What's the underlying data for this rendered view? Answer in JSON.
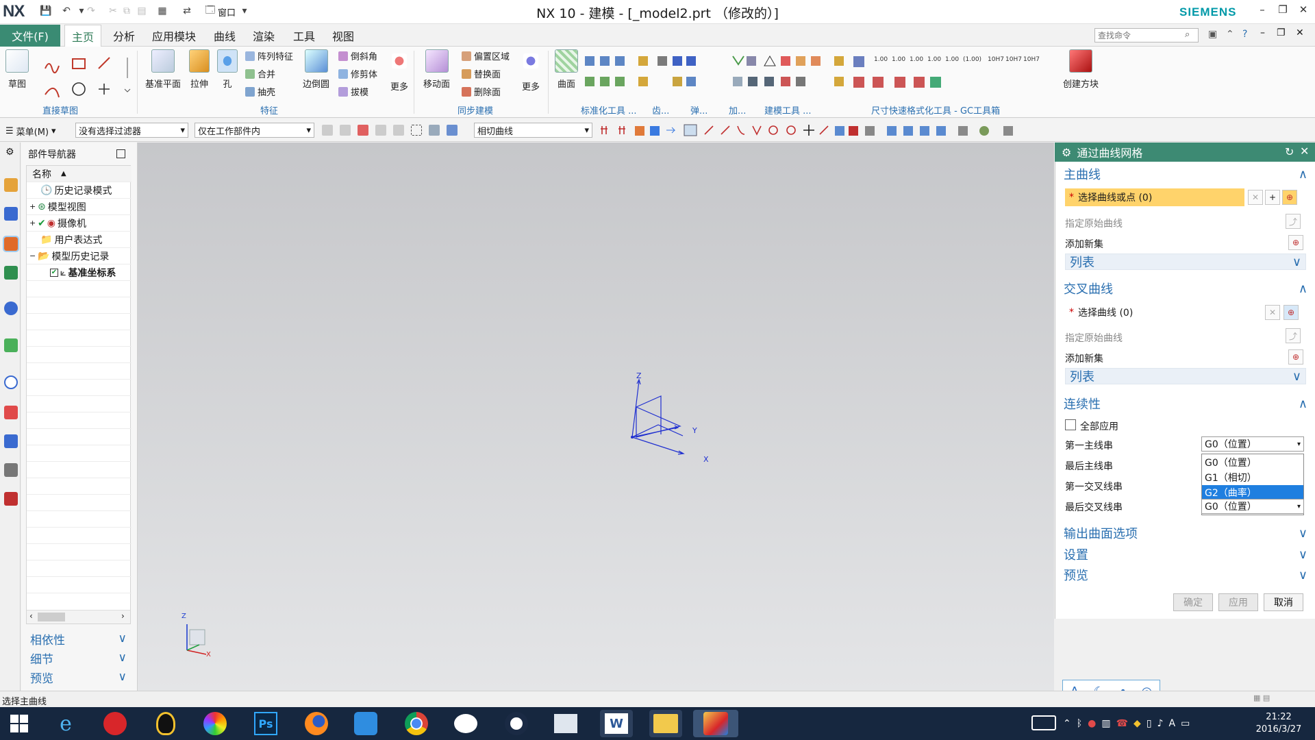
{
  "title_bar": {
    "logo": "NX",
    "window_title": "NX 10 - 建模 - [_model2.prt （修改的）]",
    "brand": "SIEMENS",
    "window_menu": "窗口"
  },
  "menu": {
    "file": "文件(F)",
    "tabs": [
      "主页",
      "分析",
      "应用模块",
      "曲线",
      "渲染",
      "工具",
      "视图"
    ],
    "active_tab": "主页",
    "search_placeholder": "查找命令"
  },
  "ribbon": {
    "sketch": {
      "label": "草图"
    },
    "direct_sketch_group": "直接草图",
    "feature": {
      "datum_plane": "基准平面",
      "extrude": "拉伸",
      "hole": "孔",
      "pattern": "阵列特征",
      "unite": "合并",
      "shell": "抽壳",
      "edge_blend": "边倒圆",
      "chamfer": "倒斜角",
      "trim_body": "修剪体",
      "draft": "拔模",
      "more": "更多"
    },
    "feature_group": "特征",
    "sync": {
      "move_face": "移动面",
      "offset_region": "偏置区域",
      "replace_face": "替换面",
      "delete_face": "删除面",
      "more": "更多"
    },
    "sync_group": "同步建模",
    "surface": {
      "label": "曲面"
    },
    "other_groups": [
      "标准化工具 ...",
      "齿...",
      "弹...",
      "加...",
      "建模工具 ...",
      "尺寸快速格式化工具 - GC工具箱"
    ],
    "dim_labels": [
      "1.00",
      "1.00",
      "1.00",
      "1.00",
      "1.00",
      "(1.00)",
      "10H7",
      "10H7",
      "10H7"
    ],
    "create_block": "创建方块"
  },
  "toolbar2": {
    "menu": "菜单(M)",
    "filter": "没有选择过滤器",
    "scope": "仅在工作部件内",
    "curve_rule": "相切曲线"
  },
  "navigator": {
    "title": "部件导航器",
    "column": "名称",
    "items": [
      {
        "label": "历史记录模式"
      },
      {
        "label": "模型视图"
      },
      {
        "label": "摄像机"
      },
      {
        "label": "用户表达式"
      },
      {
        "label": "模型历史记录"
      },
      {
        "label": "基准坐标系"
      }
    ],
    "sections": [
      "相依性",
      "细节",
      "预览"
    ]
  },
  "viewport": {
    "axis_labels": {
      "z": "Z",
      "y": "Y",
      "x": "X"
    }
  },
  "dialog": {
    "title": "通过曲线网格",
    "primary": {
      "header": "主曲线",
      "select": "选择曲线或点 (0)",
      "specify_original": "指定原始曲线",
      "add_new_set": "添加新集",
      "list": "列表"
    },
    "cross": {
      "header": "交叉曲线",
      "select": "选择曲线 (0)",
      "specify_original": "指定原始曲线",
      "add_new_set": "添加新集",
      "list": "列表"
    },
    "continuity": {
      "header": "连续性",
      "apply_all": "全部应用",
      "first_primary": "第一主线串",
      "last_primary": "最后主线串",
      "first_cross": "第一交叉线串",
      "last_cross": "最后交叉线串",
      "first_primary_value": "G0（位置）",
      "last_cross_value": "G0（位置）",
      "options": [
        "G0（位置）",
        "G1（相切）",
        "G2（曲率）"
      ],
      "highlighted_option": "G2（曲率）"
    },
    "collapsed_sections": [
      "输出曲面选项",
      "设置",
      "预览"
    ],
    "buttons": {
      "ok": "确定",
      "apply": "应用",
      "cancel": "取消"
    }
  },
  "status_bar": {
    "message": "选择主曲线"
  },
  "ime": {
    "mode": "A"
  },
  "taskbar": {
    "time": "21:22",
    "date": "2016/3/27"
  },
  "colors": {
    "accent_green": "#3a8b73",
    "link_blue": "#2a6fb0",
    "highlight_yellow": "#ffd36b",
    "selected_blue": "#1f7fe0"
  }
}
